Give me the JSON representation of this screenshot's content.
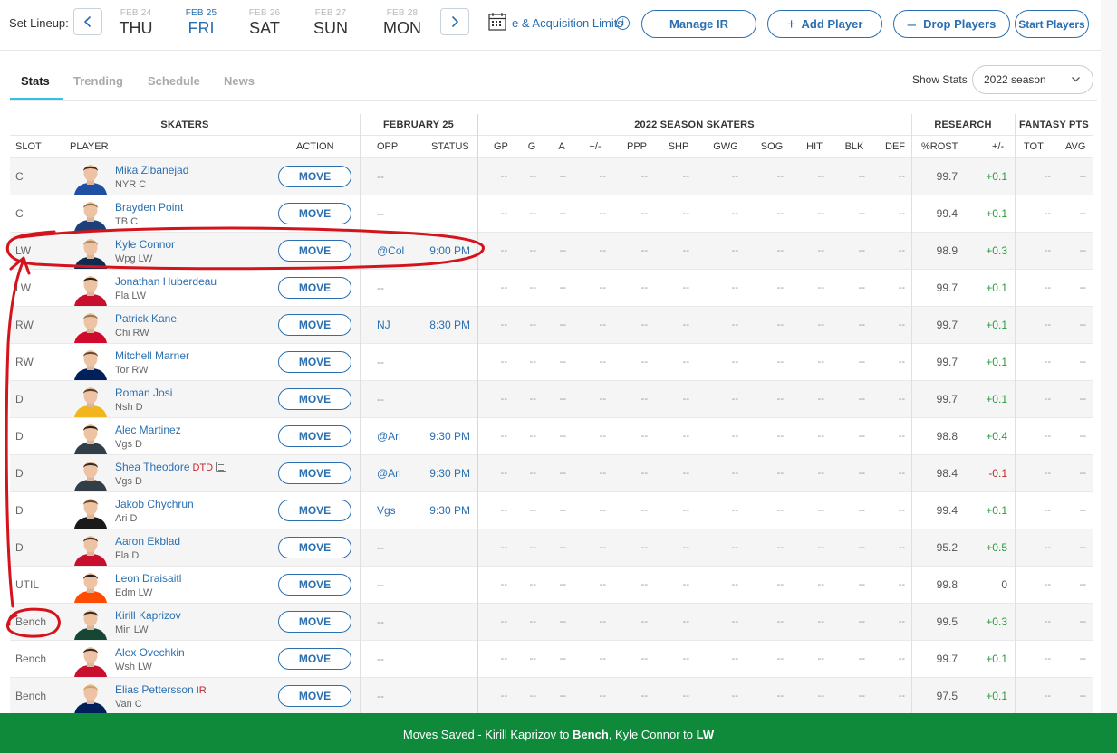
{
  "header": {
    "set_lineup_label": "Set Lineup:",
    "dates": [
      {
        "month_day": "FEB 24",
        "weekday": "THU",
        "active": false
      },
      {
        "month_day": "FEB 25",
        "weekday": "FRI",
        "active": true
      },
      {
        "month_day": "FEB 26",
        "weekday": "SAT",
        "active": false
      },
      {
        "month_day": "FEB 27",
        "weekday": "SUN",
        "active": false
      },
      {
        "month_day": "FEB 28",
        "weekday": "MON",
        "active": false
      }
    ],
    "acquisition_link": "e & Acquisition Limits",
    "buttons": {
      "manage_ir": "Manage IR",
      "add_player": "Add Player",
      "drop_players": "Drop Players",
      "start_players": "Start Players"
    },
    "icons": {
      "prev": "chevron-left-icon",
      "next": "chevron-right-icon",
      "calendar": "calendar-icon",
      "info": "info-icon"
    }
  },
  "tabs": {
    "items": [
      "Stats",
      "Trending",
      "Schedule",
      "News"
    ],
    "active": "Stats",
    "show_stats_label": "Show Stats",
    "season_value": "2022 season"
  },
  "table": {
    "groups": {
      "skaters": "SKATERS",
      "date": "FEBRUARY 25",
      "season": "2022 SEASON SKATERS",
      "research": "RESEARCH",
      "fantasy": "FANTASY PTS"
    },
    "columns": {
      "slot": "SLOT",
      "player": "PLAYER",
      "action": "ACTION",
      "opp": "OPP",
      "status": "STATUS",
      "stats": [
        "GP",
        "G",
        "A",
        "+/-",
        "PPP",
        "SHP",
        "GWG",
        "SOG",
        "HIT",
        "BLK",
        "DEF"
      ],
      "rost": "%ROST",
      "chg": "+/-",
      "tot": "TOT",
      "avg": "AVG"
    },
    "move_label": "MOVE",
    "empty": "--",
    "rows": [
      {
        "slot": "C",
        "name": "Mika Zibanejad",
        "team_pos": "NYR  C",
        "tag": "",
        "opp": "--",
        "status": "",
        "rost": "99.7",
        "chg": "+0.1",
        "jersey": "#1e4fa3",
        "hair": "#3a2a1e"
      },
      {
        "slot": "C",
        "name": "Brayden Point",
        "team_pos": "TB  C",
        "tag": "",
        "opp": "--",
        "status": "",
        "rost": "99.4",
        "chg": "+0.1",
        "jersey": "#1d3f7a",
        "hair": "#8a6a44"
      },
      {
        "slot": "LW",
        "name": "Kyle Connor",
        "team_pos": "Wpg  LW",
        "tag": "",
        "opp": "@Col",
        "status": "9:00 PM",
        "rost": "98.9",
        "chg": "+0.3",
        "jersey": "#0f2a4e",
        "hair": "#b08a5a"
      },
      {
        "slot": "LW",
        "name": "Jonathan Huberdeau",
        "team_pos": "Fla  LW",
        "tag": "",
        "opp": "--",
        "status": "",
        "rost": "99.7",
        "chg": "+0.1",
        "jersey": "#c8102e",
        "hair": "#2d2016"
      },
      {
        "slot": "RW",
        "name": "Patrick Kane",
        "team_pos": "Chi  RW",
        "tag": "",
        "opp": "NJ",
        "status": "8:30 PM",
        "rost": "99.7",
        "chg": "+0.1",
        "jersey": "#cf0a2c",
        "hair": "#9a7a52"
      },
      {
        "slot": "RW",
        "name": "Mitchell Marner",
        "team_pos": "Tor  RW",
        "tag": "",
        "opp": "--",
        "status": "",
        "rost": "99.7",
        "chg": "+0.1",
        "jersey": "#00205b",
        "hair": "#6a4a2a"
      },
      {
        "slot": "D",
        "name": "Roman Josi",
        "team_pos": "Nsh  D",
        "tag": "",
        "opp": "--",
        "status": "",
        "rost": "99.7",
        "chg": "+0.1",
        "jersey": "#f2b51c",
        "hair": "#5a3f28"
      },
      {
        "slot": "D",
        "name": "Alec Martinez",
        "team_pos": "Vgs  D",
        "tag": "",
        "opp": "@Ari",
        "status": "9:30 PM",
        "rost": "98.8",
        "chg": "+0.4",
        "jersey": "#333f48",
        "hair": "#2d2016"
      },
      {
        "slot": "D",
        "name": "Shea Theodore",
        "team_pos": "Vgs  D",
        "tag": "DTD",
        "opp": "@Ari",
        "status": "9:30 PM",
        "rost": "98.4",
        "chg": "-0.1",
        "jersey": "#333f48",
        "hair": "#3a2a1e"
      },
      {
        "slot": "D",
        "name": "Jakob Chychrun",
        "team_pos": "Ari  D",
        "tag": "",
        "opp": "Vgs",
        "status": "9:30 PM",
        "rost": "99.4",
        "chg": "+0.1",
        "jersey": "#1a1a1a",
        "hair": "#6a4a2a"
      },
      {
        "slot": "D",
        "name": "Aaron Ekblad",
        "team_pos": "Fla  D",
        "tag": "",
        "opp": "--",
        "status": "",
        "rost": "95.2",
        "chg": "+0.5",
        "jersey": "#c8102e",
        "hair": "#3a2a1e"
      },
      {
        "slot": "UTIL",
        "name": "Leon Draisaitl",
        "team_pos": "Edm  LW",
        "tag": "",
        "opp": "--",
        "status": "",
        "rost": "99.8",
        "chg": "0",
        "jersey": "#ff4c00",
        "hair": "#2d2016"
      },
      {
        "slot": "Bench",
        "name": "Kirill Kaprizov",
        "team_pos": "Min  LW",
        "tag": "",
        "opp": "--",
        "status": "",
        "rost": "99.5",
        "chg": "+0.3",
        "jersey": "#154734",
        "hair": "#3a2a1e"
      },
      {
        "slot": "Bench",
        "name": "Alex Ovechkin",
        "team_pos": "Wsh  LW",
        "tag": "",
        "opp": "--",
        "status": "",
        "rost": "99.7",
        "chg": "+0.1",
        "jersey": "#c8102e",
        "hair": "#3a2a1e"
      },
      {
        "slot": "Bench",
        "name": "Elias Pettersson",
        "team_pos": "Van  C",
        "tag": "IR",
        "opp": "--",
        "status": "",
        "rost": "97.5",
        "chg": "+0.1",
        "jersey": "#00205b",
        "hair": "#c9a46a"
      }
    ]
  },
  "toast": {
    "prefix": "Moves Saved - Kirill Kaprizov to ",
    "bench": "Bench",
    "middle": ", Kyle Connor to ",
    "lw": "LW"
  },
  "colors": {
    "accent": "#2a6fb0",
    "tab_underline": "#36c0e6",
    "toast": "#0f8a3b",
    "annotation": "#d4141c",
    "positive": "#2a9a3a",
    "negative": "#c0262c"
  }
}
